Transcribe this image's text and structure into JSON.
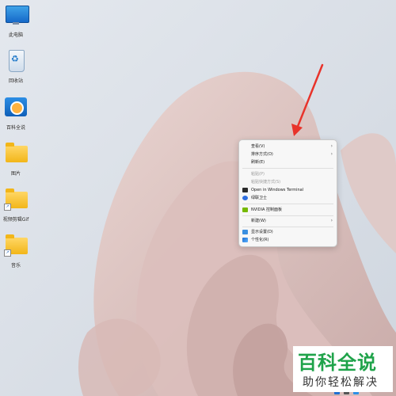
{
  "desktop": {
    "icons": [
      {
        "label": "此电脑",
        "icon": "monitor-icon"
      },
      {
        "label": "回收站",
        "icon": "recycle-bin-icon"
      },
      {
        "label": "百科全说",
        "icon": "app-icon"
      },
      {
        "label": "图片",
        "icon": "folder-icon"
      },
      {
        "label": "视频剪辑Gif",
        "icon": "folder-shortcut-icon"
      },
      {
        "label": "音乐",
        "icon": "folder-shortcut-icon"
      }
    ]
  },
  "context_menu": {
    "items": [
      {
        "label": "查看(V)",
        "submenu": true,
        "disabled": false
      },
      {
        "label": "排序方式(O)",
        "submenu": true,
        "disabled": false
      },
      {
        "label": "刷新(E)",
        "submenu": false,
        "disabled": false
      },
      {
        "label": "粘贴(P)",
        "submenu": false,
        "disabled": true
      },
      {
        "label": "粘贴快捷方式(S)",
        "submenu": false,
        "disabled": true
      },
      {
        "label": "Open in Windows Terminal",
        "submenu": false,
        "disabled": false,
        "icon": "terminal-icon"
      },
      {
        "label": "绿联卫士",
        "submenu": false,
        "disabled": false,
        "icon": "shield-app-icon"
      },
      {
        "label": "NVIDIA 控制面板",
        "submenu": false,
        "disabled": false,
        "icon": "nvidia-icon"
      },
      {
        "label": "新建(W)",
        "submenu": true,
        "disabled": false
      },
      {
        "label": "显示设置(D)",
        "submenu": false,
        "disabled": false,
        "icon": "display-settings-icon"
      },
      {
        "label": "个性化(R)",
        "submenu": false,
        "disabled": false,
        "icon": "personalize-icon"
      }
    ]
  },
  "watermark": {
    "title": "百科全说",
    "subtitle": "助你轻松解决"
  },
  "colors": {
    "accent_arrow": "#e8332a",
    "watermark_green": "#1fa34a",
    "wallpaper_petal": "#e3c8c4"
  }
}
